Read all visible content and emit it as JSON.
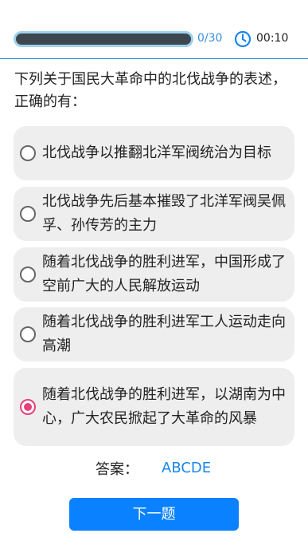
{
  "header": {
    "progress_fraction": 0,
    "progress_text": "0/30",
    "timer_icon": "clock-icon",
    "timer_text": "00:10"
  },
  "question": {
    "text": "下列关于国民大革命中的北伐战争的表述，正确的有："
  },
  "options": [
    {
      "label": "北伐战争以推翻北洋军阀统治为目标",
      "selected": false
    },
    {
      "label": "北伐战争先后基本摧毁了北洋军阀吴佩孚、孙传芳的主力",
      "selected": false
    },
    {
      "label": "随着北伐战争的胜利进军，中国形成了空前广大的人民解放运动",
      "selected": false
    },
    {
      "label": "随着北伐战争的胜利进军工人运动走向高潮",
      "selected": false
    },
    {
      "label": "随着北伐战争的胜利进军，以湖南为中心，广大农民掀起了大革命的风暴",
      "selected": true
    }
  ],
  "answer": {
    "label": "答案：",
    "value": "ABCDE"
  },
  "next_button": {
    "label": "下一题"
  },
  "colors": {
    "accent": "#0a82ff",
    "selected_radio": "#e8407a",
    "option_bg": "#eeeeee"
  }
}
